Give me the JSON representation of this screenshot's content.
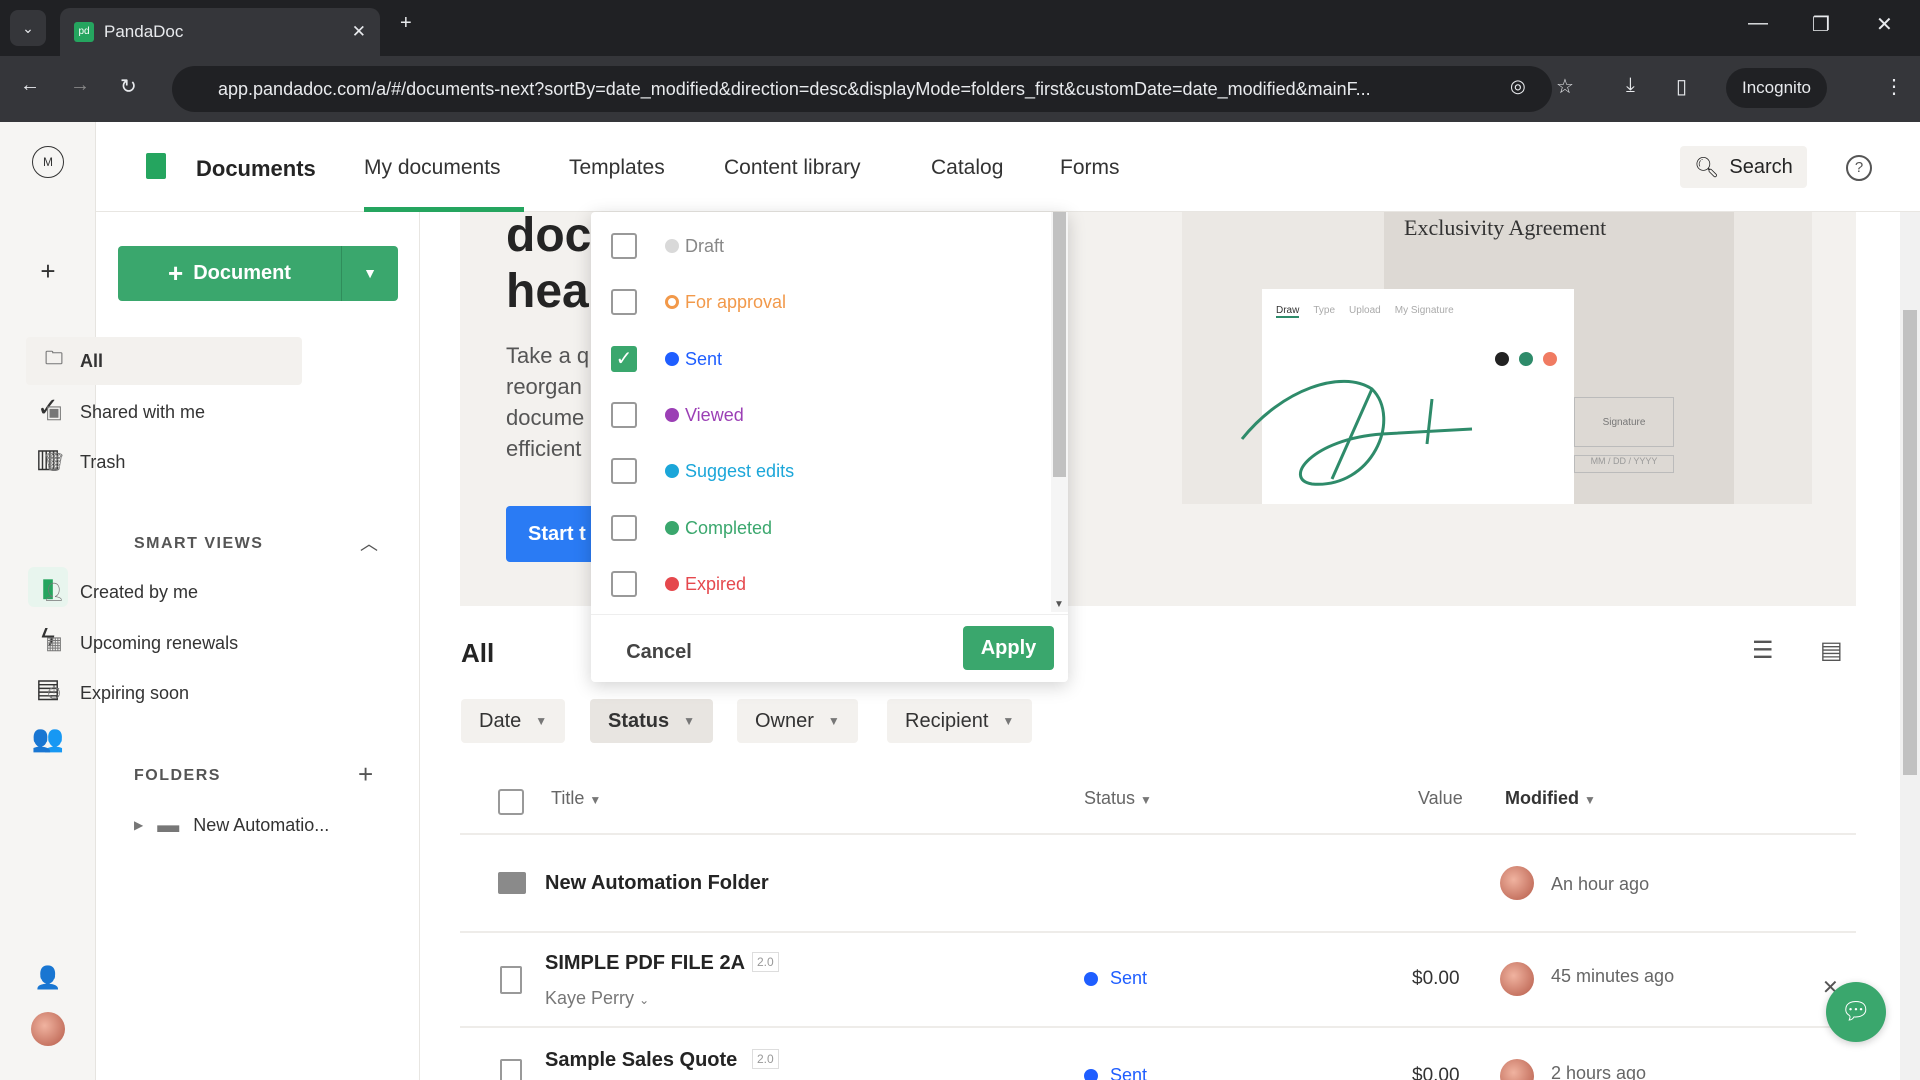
{
  "browser": {
    "tab_title": "PandaDoc",
    "url": "app.pandadoc.com/a/#/documents-next?sortBy=date_modified&direction=desc&displayMode=folders_first&customDate=date_modified&mainF...",
    "incognito": "Incognito"
  },
  "header": {
    "title": "Documents",
    "tabs": [
      "My documents",
      "Templates",
      "Content library",
      "Catalog",
      "Forms"
    ],
    "active_tab": "My documents",
    "search": "Search"
  },
  "sidebar": {
    "new_document": "Document",
    "items": [
      "All",
      "Shared with me",
      "Trash"
    ],
    "smart_views_title": "SMART VIEWS",
    "smart_views": [
      "Created by me",
      "Upcoming renewals",
      "Expiring soon"
    ],
    "folders_title": "FOLDERS",
    "folders": [
      "New Automatio..."
    ]
  },
  "banner": {
    "heading_line1": "doc",
    "heading_line2": "hea",
    "text": [
      "Take a q",
      "reorgan",
      "docume",
      "efficient"
    ],
    "button": "Start t",
    "image": {
      "doc_title": "Exclusivity Agreement",
      "sig_tabs": [
        "Draw",
        "Type",
        "Upload",
        "My Signature"
      ],
      "sig_box": "Signature",
      "date_placeholder": "MM / DD / YYYY"
    }
  },
  "status_filter": {
    "options": [
      {
        "label": "Draft",
        "color": "#d9d9d9",
        "checked": false
      },
      {
        "label": "For approval",
        "color": "#f2994a",
        "checked": false
      },
      {
        "label": "Sent",
        "color": "#1f5eff",
        "checked": true
      },
      {
        "label": "Viewed",
        "color": "#9b3fb5",
        "checked": false
      },
      {
        "label": "Suggest edits",
        "color": "#1ba6d9",
        "checked": false
      },
      {
        "label": "Completed",
        "color": "#3aa76d",
        "checked": false
      },
      {
        "label": "Expired",
        "color": "#e5484d",
        "checked": false
      }
    ],
    "cancel": "Cancel",
    "apply": "Apply"
  },
  "list": {
    "title": "All",
    "filters": [
      "Date",
      "Status",
      "Owner",
      "Recipient"
    ],
    "columns": [
      "Title",
      "Status",
      "Value",
      "Modified"
    ],
    "rows": [
      {
        "type": "folder",
        "title": "New Automation Folder",
        "modified": "An hour ago"
      },
      {
        "type": "document",
        "title": "SIMPLE PDF FILE 2A",
        "version": "2.0",
        "owner": "Kaye Perry",
        "status": "Sent",
        "value": "$0.00",
        "modified": "45 minutes ago"
      },
      {
        "type": "document",
        "title": "Sample Sales Quote",
        "version": "2.0",
        "status": "Sent",
        "value": "$0.00",
        "modified": "2 hours ago"
      }
    ]
  },
  "colors": {
    "brand_green": "#25a55f",
    "sent_blue": "#1f5eff",
    "start_blue": "#2a7bf4"
  }
}
